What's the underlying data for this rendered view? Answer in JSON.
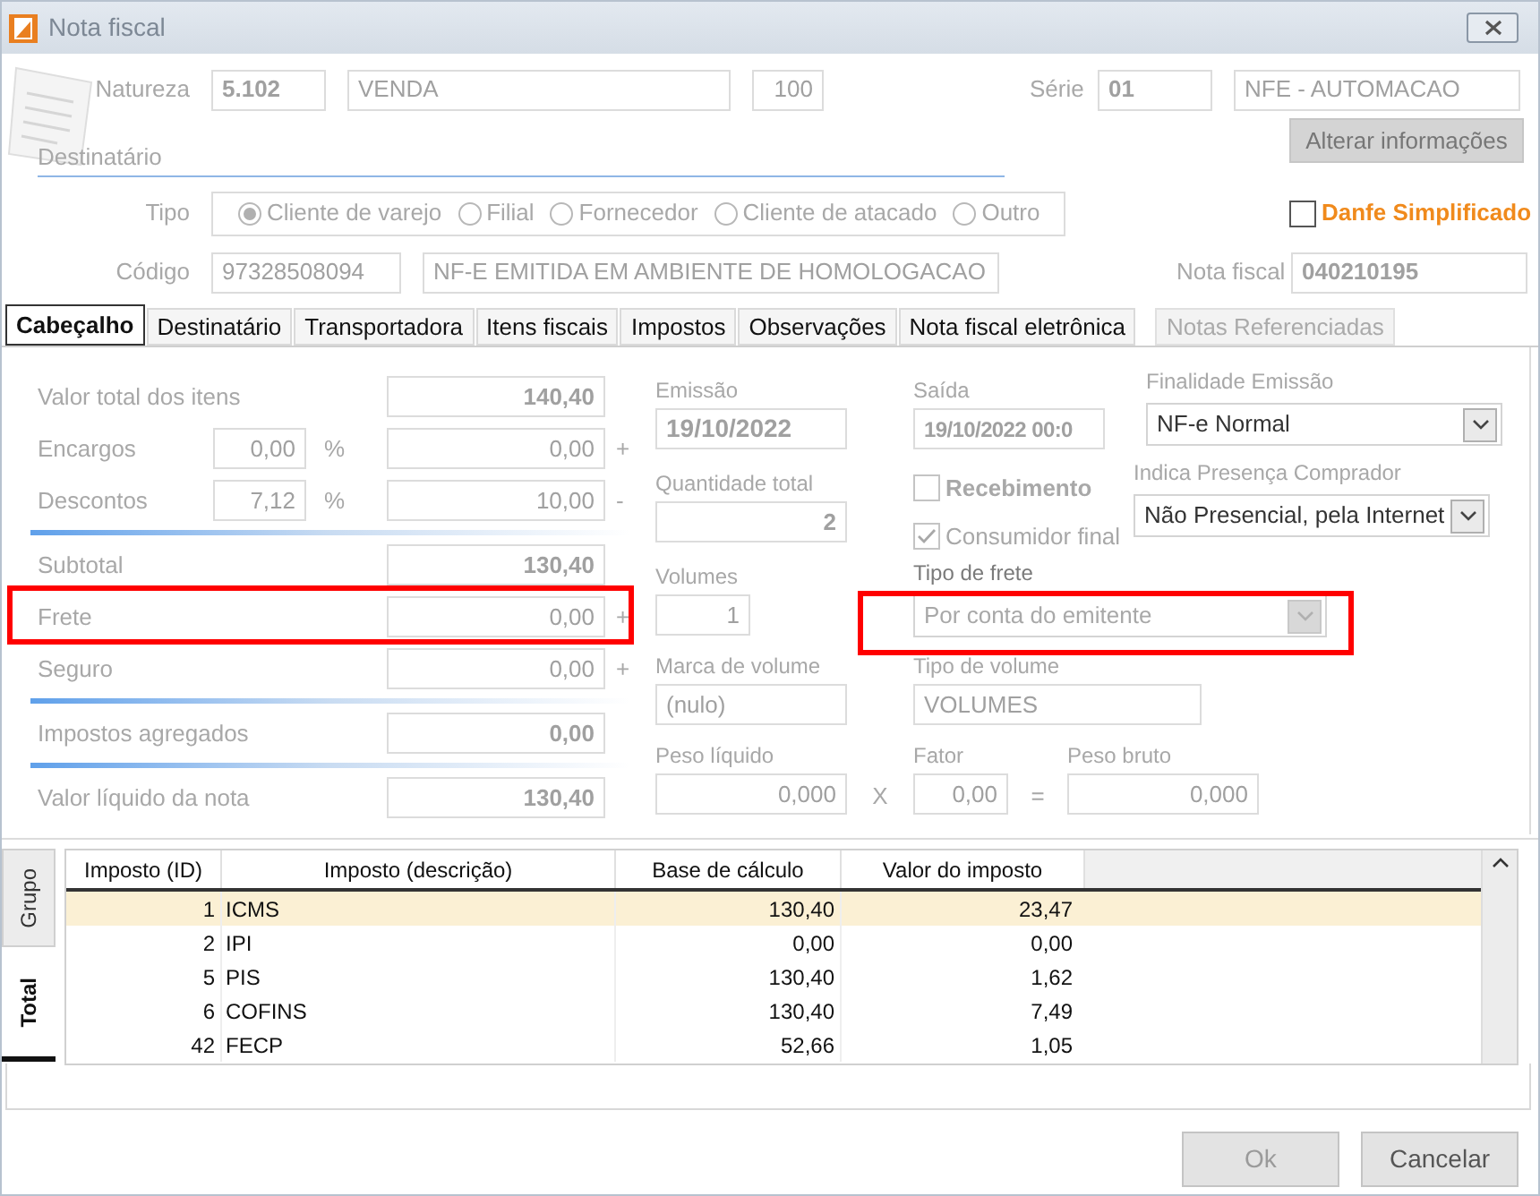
{
  "window": {
    "title": "Nota fiscal"
  },
  "header": {
    "natureza": {
      "label": "Natureza",
      "code": "5.102",
      "description": "VENDA",
      "number": "100"
    },
    "serie": {
      "label": "Série",
      "code": "01",
      "description": "NFE - AUTOMACAO"
    },
    "alter_button": {
      "label": "Alterar informações",
      "disabled": true
    },
    "destinatario_label": "Destinatário",
    "tipo": {
      "label": "Tipo",
      "options": [
        {
          "label": "Cliente de varejo",
          "selected": true
        },
        {
          "label": "Filial",
          "selected": false
        },
        {
          "label": "Fornecedor",
          "selected": false
        },
        {
          "label": "Cliente de atacado",
          "selected": false
        },
        {
          "label": "Outro",
          "selected": false
        }
      ]
    },
    "danfe": {
      "label": "Danfe Simplificado",
      "checked": false
    },
    "codigo": {
      "label": "Código",
      "code": "97328508094",
      "name": "NF-E EMITIDA EM AMBIENTE DE HOMOLOGACAO"
    },
    "nota_fiscal": {
      "label": "Nota fiscal",
      "value": "040210195"
    }
  },
  "tabs": [
    {
      "label": "Cabeçalho",
      "selected": true,
      "disabled": false
    },
    {
      "label": "Destinatário",
      "selected": false,
      "disabled": false
    },
    {
      "label": "Transportadora",
      "selected": false,
      "disabled": false
    },
    {
      "label": "Itens fiscais",
      "selected": false,
      "disabled": false
    },
    {
      "label": "Impostos",
      "selected": false,
      "disabled": false
    },
    {
      "label": "Observações",
      "selected": false,
      "disabled": false
    },
    {
      "label": "Nota fiscal eletrônica",
      "selected": false,
      "disabled": false
    },
    {
      "label": "Notas Referenciadas",
      "selected": false,
      "disabled": true
    }
  ],
  "totals": [
    {
      "kind": "total",
      "label": "Valor total dos itens",
      "value": "140,40",
      "separator_before": false,
      "highlighted": false
    },
    {
      "kind": "percent",
      "label": "Encargos",
      "percent": "0,00",
      "percent_sign": "%",
      "value": "0,00",
      "sign": "+",
      "separator_before": false,
      "highlighted": false
    },
    {
      "kind": "percent",
      "label": "Descontos",
      "percent": "7,12",
      "percent_sign": "%",
      "value": "10,00",
      "sign": "-",
      "separator_before": false,
      "highlighted": false
    },
    {
      "kind": "total",
      "label": "Subtotal",
      "value": "130,40",
      "separator_before": true,
      "highlighted": false
    },
    {
      "kind": "plain",
      "label": "Frete",
      "value": "0,00",
      "sign": "+",
      "separator_before": false,
      "highlighted": true
    },
    {
      "kind": "plain",
      "label": "Seguro",
      "value": "0,00",
      "sign": "+",
      "separator_before": false,
      "highlighted": false
    },
    {
      "kind": "total",
      "label": "Impostos agregados",
      "value": "0,00",
      "separator_before": true,
      "highlighted": false
    },
    {
      "kind": "total",
      "label": "Valor líquido da nota",
      "value": "130,40",
      "separator_before": true,
      "highlighted": false
    }
  ],
  "details": {
    "emissao": {
      "label": "Emissão",
      "value": "19/10/2022"
    },
    "saida": {
      "label": "Saída",
      "value": "19/10/2022 00:0"
    },
    "finalidade": {
      "label": "Finalidade Emissão",
      "value": "NF-e Normal"
    },
    "quantidade": {
      "label": "Quantidade total",
      "value": "2"
    },
    "recebimento": {
      "label": "Recebimento",
      "checked": false
    },
    "consumidor_final": {
      "label": "Consumidor final",
      "checked": true
    },
    "presenca": {
      "label": "Indica Presença Comprador",
      "value": "Não Presencial, pela Internet"
    },
    "volumes": {
      "label": "Volumes",
      "value": "1"
    },
    "tipo_frete": {
      "label": "Tipo de frete",
      "value": "Por conta do emitente",
      "highlighted": true
    },
    "marca_volume": {
      "label": "Marca de volume",
      "value": "(nulo)"
    },
    "tipo_volume": {
      "label": "Tipo de volume",
      "value": "VOLUMES"
    },
    "peso_liquido": {
      "label": "Peso líquido",
      "value": "0,000"
    },
    "times": "X",
    "fator": {
      "label": "Fator",
      "value": "0,00"
    },
    "equals": "=",
    "peso_bruto": {
      "label": "Peso bruto",
      "value": "0,000"
    }
  },
  "side_tabs": [
    {
      "label": "Grupo",
      "selected": false
    },
    {
      "label": "Total",
      "selected": true
    }
  ],
  "table": {
    "columns": [
      "Imposto (ID)",
      "Imposto (descrição)",
      "Base de cálculo",
      "Valor do imposto"
    ],
    "rows": [
      {
        "id": "1",
        "description": "ICMS",
        "base": "130,40",
        "value": "23,47",
        "selected": true
      },
      {
        "id": "2",
        "description": "IPI",
        "base": "0,00",
        "value": "0,00",
        "selected": false
      },
      {
        "id": "5",
        "description": "PIS",
        "base": "130,40",
        "value": "1,62",
        "selected": false
      },
      {
        "id": "6",
        "description": "COFINS",
        "base": "130,40",
        "value": "7,49",
        "selected": false
      },
      {
        "id": "42",
        "description": "FECP",
        "base": "52,66",
        "value": "1,05",
        "selected": false
      }
    ]
  },
  "buttons": [
    {
      "label": "Ok",
      "disabled": true
    },
    {
      "label": "Cancelar",
      "disabled": false
    }
  ]
}
